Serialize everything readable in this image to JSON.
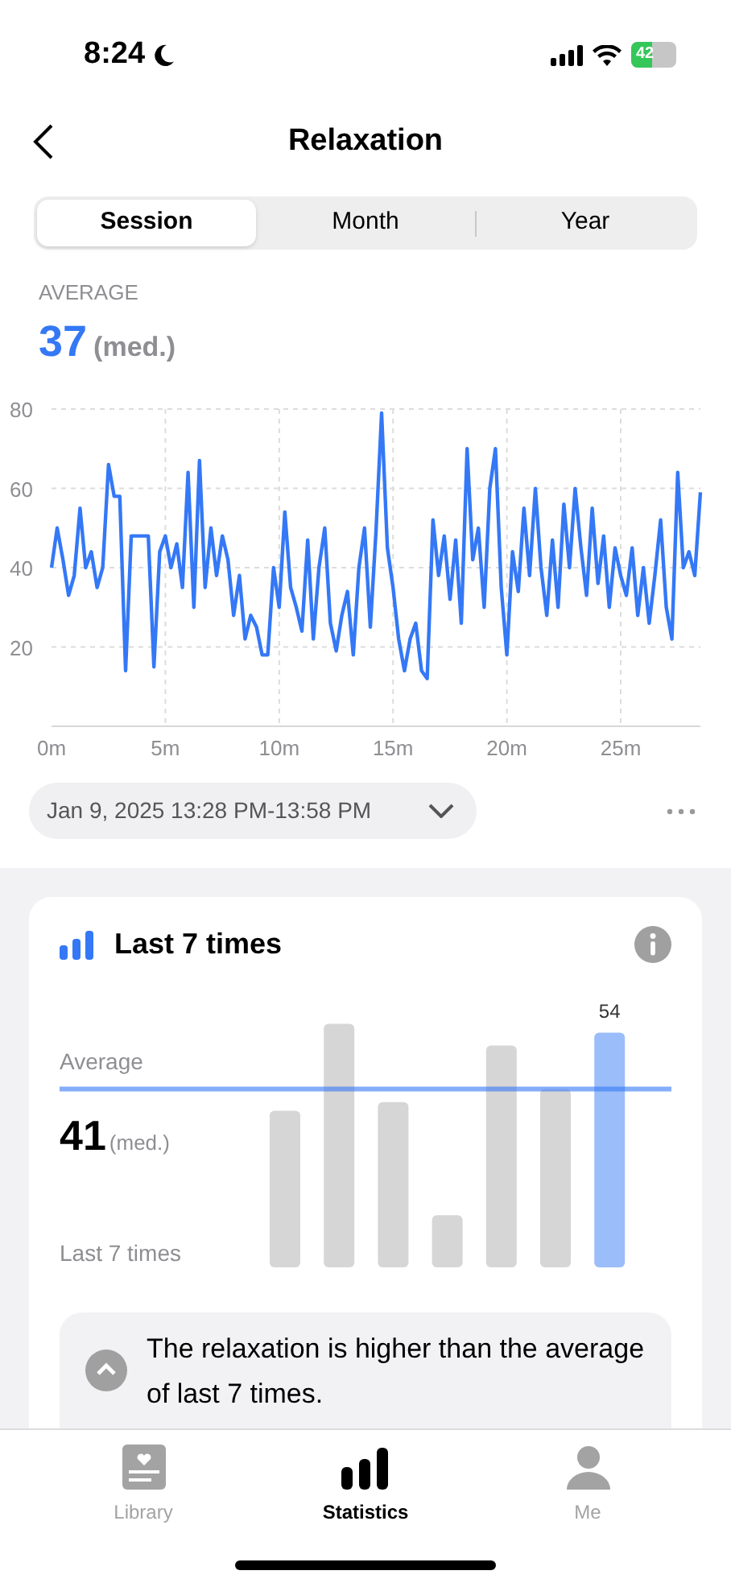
{
  "status_bar": {
    "time": "8:24",
    "battery": "42"
  },
  "nav": {
    "title": "Relaxation"
  },
  "segments": [
    {
      "label": "Session",
      "selected": true
    },
    {
      "label": "Month",
      "selected": false
    },
    {
      "label": "Year",
      "selected": false
    }
  ],
  "average": {
    "label": "AVERAGE",
    "value": "37",
    "unit": "(med.)"
  },
  "session_chart": {
    "chart_data": {
      "type": "line",
      "grid": true,
      "xlim": [
        0,
        28.5
      ],
      "ylim": [
        0,
        80
      ],
      "yticks": [
        20,
        40,
        60,
        80
      ],
      "xticks": [
        {
          "value": 0,
          "label": "0m"
        },
        {
          "value": 5,
          "label": "5m"
        },
        {
          "value": 10,
          "label": "10m"
        },
        {
          "value": 15,
          "label": "15m"
        },
        {
          "value": 20,
          "label": "20m"
        },
        {
          "value": 25,
          "label": "25m"
        }
      ],
      "x": [
        0,
        0.25,
        0.5,
        0.75,
        1,
        1.25,
        1.5,
        1.75,
        2,
        2.25,
        2.5,
        2.75,
        3,
        3.25,
        3.5,
        3.75,
        4,
        4.25,
        4.5,
        4.75,
        5,
        5.25,
        5.5,
        5.75,
        6,
        6.25,
        6.5,
        6.75,
        7,
        7.25,
        7.5,
        7.75,
        8,
        8.25,
        8.5,
        8.75,
        9,
        9.25,
        9.5,
        9.75,
        10,
        10.25,
        10.5,
        10.75,
        11,
        11.25,
        11.5,
        11.75,
        12,
        12.25,
        12.5,
        12.75,
        13,
        13.25,
        13.5,
        13.75,
        14,
        14.25,
        14.5,
        14.75,
        15,
        15.25,
        15.5,
        15.75,
        16,
        16.25,
        16.5,
        16.75,
        17,
        17.25,
        17.5,
        17.75,
        18,
        18.25,
        18.5,
        18.75,
        19,
        19.25,
        19.5,
        19.75,
        20,
        20.25,
        20.5,
        20.75,
        21,
        21.25,
        21.5,
        21.75,
        22,
        22.25,
        22.5,
        22.75,
        23,
        23.25,
        23.5,
        23.75,
        24,
        24.25,
        24.5,
        24.75,
        25,
        25.25,
        25.5,
        25.75,
        26,
        26.25,
        26.5,
        26.75,
        27,
        27.25,
        27.5,
        27.75,
        28,
        28.25,
        28.5
      ],
      "series": [
        {
          "color": "#3478f6",
          "values": [
            40,
            50,
            42,
            33,
            38,
            55,
            40,
            44,
            35,
            40,
            66,
            58,
            58,
            14,
            48,
            48,
            48,
            48,
            15,
            44,
            48,
            40,
            46,
            35,
            64,
            30,
            67,
            35,
            50,
            38,
            48,
            42,
            28,
            38,
            22,
            28,
            25,
            18,
            18,
            40,
            30,
            54,
            35,
            30,
            24,
            47,
            22,
            40,
            50,
            26,
            19,
            28,
            34,
            18,
            40,
            50,
            25,
            49,
            79,
            45,
            35,
            22,
            14,
            22,
            26,
            14,
            12,
            52,
            38,
            48,
            32,
            47,
            26,
            70,
            42,
            50,
            30,
            60,
            70,
            35,
            18,
            44,
            34,
            55,
            38,
            60,
            40,
            28,
            47,
            30,
            56,
            40,
            60,
            45,
            33,
            55,
            36,
            48,
            30,
            45,
            38,
            33,
            45,
            28,
            40,
            26,
            38,
            52,
            30,
            22,
            64,
            40,
            44,
            38,
            59
          ]
        }
      ]
    }
  },
  "date_range": {
    "label": "Jan 9, 2025 13:28 PM-13:58 PM"
  },
  "card": {
    "title": "Last 7 times",
    "average_label": "Average",
    "value": "41",
    "unit": "(med.)",
    "footer_label": "Last 7 times",
    "bars": [
      {
        "selected": false
      },
      {
        "selected": false
      },
      {
        "selected": false
      },
      {
        "selected": false
      },
      {
        "selected": false
      },
      {
        "selected": false
      },
      {
        "selected": true,
        "label": "54"
      }
    ],
    "insight": "The relaxation is higher than the average of last 7 times."
  },
  "tab_bar": [
    {
      "label": "Library",
      "selected": false
    },
    {
      "label": "Statistics",
      "selected": true
    },
    {
      "label": "Me",
      "selected": false
    }
  ]
}
